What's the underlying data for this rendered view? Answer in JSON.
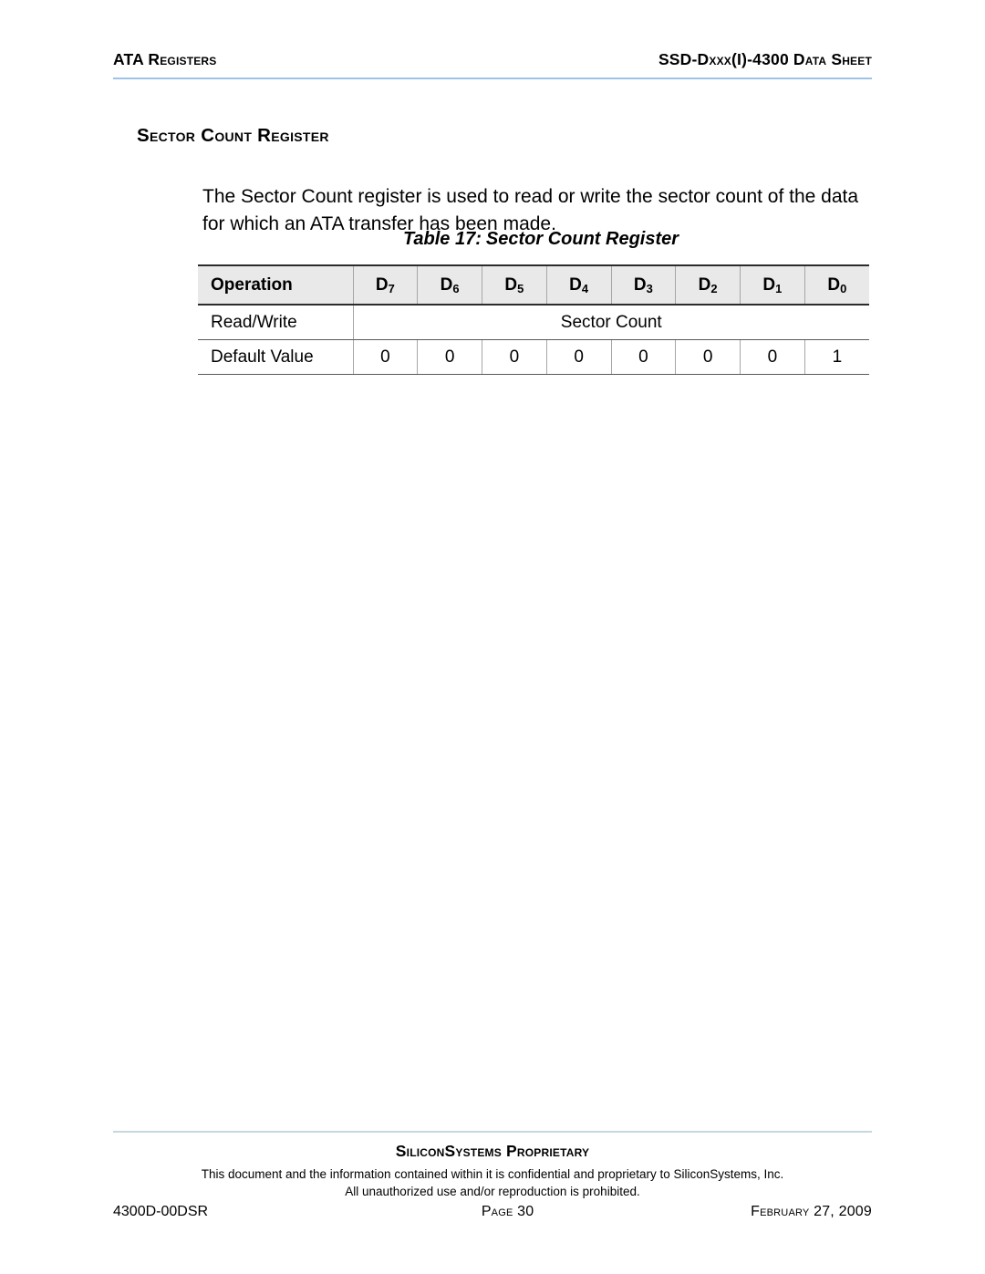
{
  "header": {
    "left_title": "ATA Registers",
    "right_title": "SSD-Dxxx(I)-4300 Data Sheet",
    "rule_color": "#9dc3e6"
  },
  "section": {
    "title": "Sector Count Register"
  },
  "body": {
    "paragraph": "The Sector Count register is used to read or write the sector count of the data for which an ATA transfer has been made."
  },
  "table": {
    "caption_label": "Table 17:",
    "caption_title": "Sector Count Register",
    "header_bg": "#e9e9e9",
    "columns": [
      {
        "label": "Operation",
        "sub": ""
      },
      {
        "label": "D",
        "sub": "7"
      },
      {
        "label": "D",
        "sub": "6"
      },
      {
        "label": "D",
        "sub": "5"
      },
      {
        "label": "D",
        "sub": "4"
      },
      {
        "label": "D",
        "sub": "3"
      },
      {
        "label": "D",
        "sub": "2"
      },
      {
        "label": "D",
        "sub": "1"
      },
      {
        "label": "D",
        "sub": "0"
      }
    ],
    "rows": [
      {
        "label": "Read/Write",
        "merged": true,
        "merged_value": "Sector Count",
        "values": []
      },
      {
        "label": "Default Value",
        "merged": false,
        "merged_value": "",
        "values": [
          "0",
          "0",
          "0",
          "0",
          "0",
          "0",
          "0",
          "1"
        ]
      }
    ]
  },
  "footer": {
    "rule_color": "#c5d9dd",
    "proprietary": "SiliconSystems Proprietary",
    "legal_line1": "This document and the information contained within it is confidential and proprietary to SiliconSystems, Inc.",
    "legal_line2": "All unauthorized use and/or reproduction is prohibited.",
    "doc_id": "4300D-00DSR",
    "page": "Page 30",
    "date": "February 27, 2009"
  }
}
